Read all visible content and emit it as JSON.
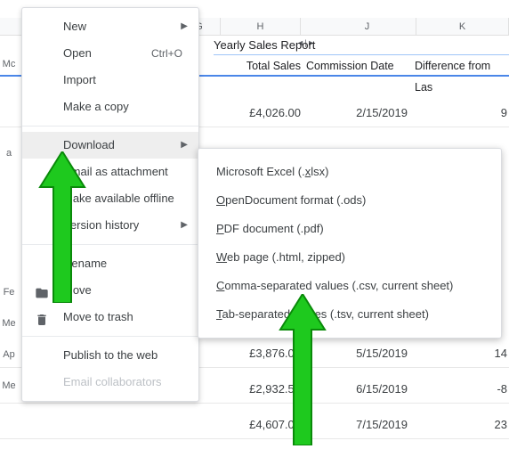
{
  "sheet": {
    "title": "Yearly Sales Report",
    "columns": {
      "g": "G",
      "h": "H",
      "j": "J",
      "k": "K"
    },
    "headers": {
      "total_sales": "Total Sales",
      "commission_date": "Commission Date",
      "difference": "Difference from Las"
    },
    "rows": [
      {
        "total_sales": "£4,026.00",
        "commission_date": "2/15/2019",
        "diff": "9"
      },
      {
        "total_sales": "£3,876.00",
        "commission_date": "5/15/2019",
        "diff": "14"
      },
      {
        "total_sales": "£2,932.50",
        "commission_date": "6/15/2019",
        "diff": "-8"
      },
      {
        "total_sales": "£4,607.00",
        "commission_date": "7/15/2019",
        "diff": "23"
      }
    ],
    "row_labels": {
      "mc": "Mc",
      "a": "a",
      "fe": "Fe",
      "me1": "Me",
      "ap": "Ap",
      "me2": "Me"
    }
  },
  "menu": {
    "new": "New",
    "open": "Open",
    "open_shortcut": "Ctrl+O",
    "import": "Import",
    "make_copy": "Make a copy",
    "download": "Download",
    "email_attachment": "Email as attachment",
    "make_offline": "Make available offline",
    "version_history": "Version history",
    "rename": "Rename",
    "move": "Move",
    "move_trash": "Move to trash",
    "publish_web": "Publish to the web",
    "email_collab": "Email collaborators"
  },
  "submenu": {
    "xlsx_pre": "Microsoft Excel (.",
    "xlsx_u": "x",
    "xlsx_post": "lsx)",
    "ods_u": "O",
    "ods_post": "penDocument format (.ods)",
    "pdf_u": "P",
    "pdf_post": "DF document (.pdf)",
    "web_u": "W",
    "web_post": "eb page (.html, zipped)",
    "csv_u": "C",
    "csv_post": "omma-separated values (.csv, current sheet)",
    "tsv_u": "T",
    "tsv_post": "ab-separated values (.tsv, current sheet)"
  }
}
